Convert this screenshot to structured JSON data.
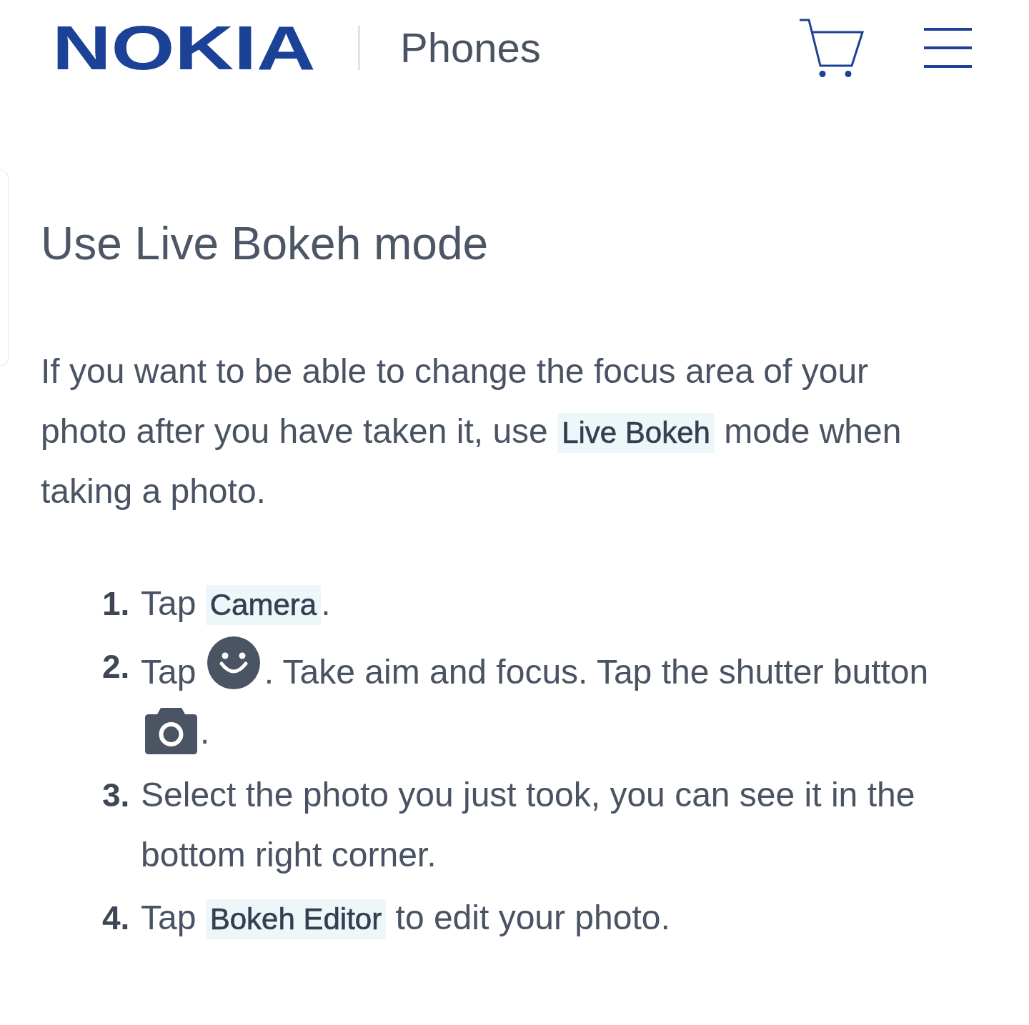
{
  "header": {
    "logo": "NOKIA",
    "section": "Phones"
  },
  "article": {
    "title": "Use Live Bokeh mode",
    "intro": [
      {
        "kind": "text",
        "text": "If you want to be able to change the focus area of your photo after you have taken it, use "
      },
      {
        "kind": "term",
        "text": "Live Bokeh"
      },
      {
        "kind": "text",
        "text": " mode when taking a photo."
      }
    ],
    "steps": [
      {
        "number": "1.",
        "content": [
          {
            "kind": "text",
            "text": "Tap "
          },
          {
            "kind": "term",
            "text": "Camera"
          },
          {
            "kind": "text",
            "text": "."
          }
        ]
      },
      {
        "number": "2.",
        "content": [
          {
            "kind": "text",
            "text": "Tap "
          },
          {
            "kind": "smiley"
          },
          {
            "kind": "text",
            "text": ". Take aim and focus. Tap the shutter button "
          },
          {
            "kind": "camera"
          },
          {
            "kind": "text",
            "text": "."
          }
        ]
      },
      {
        "number": "3.",
        "content": [
          {
            "kind": "text",
            "text": "Select the photo you just took, you can see it in the bottom right corner."
          }
        ]
      },
      {
        "number": "4.",
        "content": [
          {
            "kind": "text",
            "text": "Tap "
          },
          {
            "kind": "term",
            "text": "Bokeh Editor"
          },
          {
            "kind": "text",
            "text": " to edit your photo."
          }
        ]
      }
    ]
  }
}
